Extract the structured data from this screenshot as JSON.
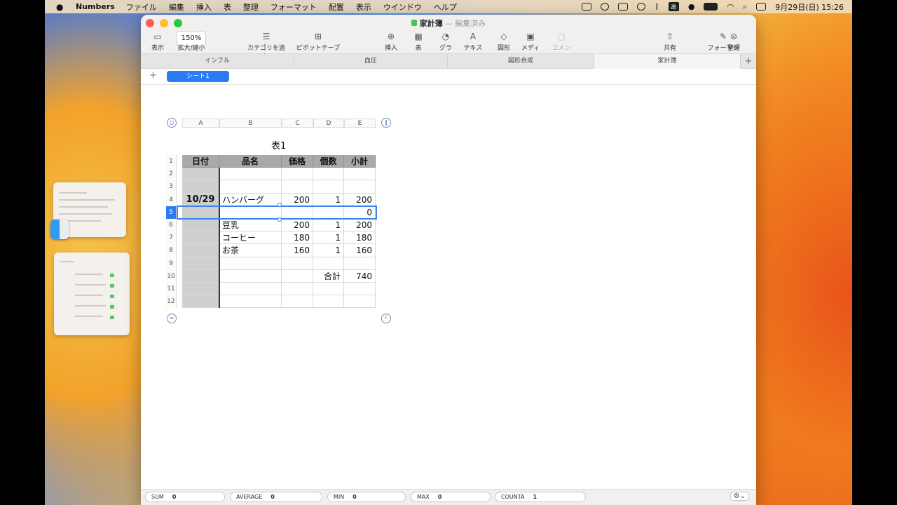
{
  "menubar": {
    "app": "Numbers",
    "items": [
      "ファイル",
      "編集",
      "挿入",
      "表",
      "整理",
      "フォーマット",
      "配置",
      "表示",
      "ウインドウ",
      "ヘルプ"
    ],
    "clock": "9月29日(日)  15:26",
    "input_method": "あ"
  },
  "window": {
    "title": "家計簿",
    "title_suffix": "— 編集済み"
  },
  "toolbar": {
    "view_label": "表示",
    "zoom_value": "150%",
    "zoom_label": "拡大/縮小",
    "category_label": "カテゴリを追加",
    "pivot_label": "ピボットテーブル",
    "insert_label": "挿入",
    "table_label": "表",
    "chart_label": "グラフ",
    "text_label": "テキスト",
    "shape_label": "図形",
    "media_label": "メディア",
    "comment_label": "コメント",
    "share_label": "共有",
    "format_label": "フォーマット",
    "organize_label": "整理"
  },
  "doc_tabs": [
    "インフル",
    "血圧",
    "図形合成",
    "家計簿"
  ],
  "sheet_tab": "シート1",
  "table": {
    "title": "表1",
    "columns": [
      "A",
      "B",
      "C",
      "D",
      "E"
    ],
    "headers": [
      "日付",
      "品名",
      "価格",
      "個数",
      "小計"
    ],
    "rows": [
      [
        "",
        "",
        "",
        "",
        ""
      ],
      [
        "",
        "",
        "",
        "",
        ""
      ],
      [
        "10/29",
        "ハンバーグ",
        "200",
        "1",
        "200"
      ],
      [
        "",
        "",
        "",
        "",
        "0"
      ],
      [
        "",
        "豆乳",
        "200",
        "1",
        "200"
      ],
      [
        "",
        "コーヒー",
        "180",
        "1",
        "180"
      ],
      [
        "",
        "お茶",
        "160",
        "1",
        "160"
      ],
      [
        "",
        "",
        "",
        "",
        ""
      ],
      [
        "",
        "",
        "",
        "合計",
        "740"
      ],
      [
        "",
        "",
        "",
        "",
        ""
      ],
      [
        "",
        "",
        "",
        "",
        ""
      ]
    ],
    "row_numbers": [
      "1",
      "2",
      "3",
      "4",
      "5",
      "6",
      "7",
      "8",
      "9",
      "10",
      "11",
      "12"
    ],
    "selected_row": "5"
  },
  "statusbar": {
    "sum_label": "SUM",
    "sum_value": "0",
    "avg_label": "AVERAGE",
    "avg_value": "0",
    "min_label": "MIN",
    "min_value": "0",
    "max_label": "MAX",
    "max_value": "0",
    "counta_label": "COUNTA",
    "counta_value": "1"
  },
  "colors": {
    "accent": "#2b7cf0",
    "header_fill": "#a9a9a9",
    "date_column_fill": "#cfcfcf"
  }
}
